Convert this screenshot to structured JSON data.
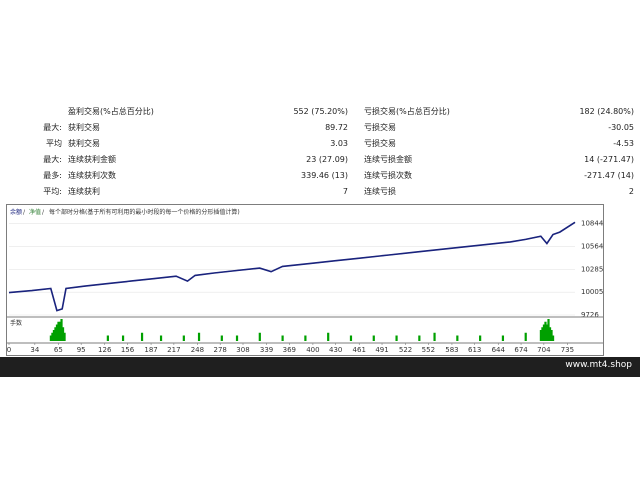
{
  "stats": {
    "rows": [
      {
        "prefix": "",
        "label1": "盈利交易(%占总百分比)",
        "value1": "552 (75.20%)",
        "label2": "亏损交易(%占总百分比)",
        "value2": "182 (24.80%)"
      },
      {
        "prefix": "最大:",
        "label1": "获利交易",
        "value1": "89.72",
        "label2": "亏损交易",
        "value2": "-30.05"
      },
      {
        "prefix": "平均",
        "label1": "获利交易",
        "value1": "3.03",
        "label2": "亏损交易",
        "value2": "-4.53"
      },
      {
        "prefix": "最大:",
        "label1": "连续获利金额",
        "value1": "23 (27.09)",
        "label2": "连续亏损金额",
        "value2": "14 (-271.47)"
      },
      {
        "prefix": "最多:",
        "label1": "连续获利次数",
        "value1": "339.46 (13)",
        "label2": "连续亏损次数",
        "value2": "-271.47 (14)"
      },
      {
        "prefix": "平均:",
        "label1": "连续获利",
        "value1": "7",
        "label2": "连续亏损",
        "value2": "2"
      }
    ]
  },
  "chart": {
    "legend_balance": "余额",
    "legend_equity": "净值",
    "legend_desc": "每个部时分格(基于所有可利用的最小时段的每一个价格的分形插值计算)",
    "volume_label": "手数",
    "colors": {
      "balance": "#1a237e",
      "equity": "#2e7d32",
      "volume": "#00a000"
    }
  },
  "chart_data": {
    "type": "line",
    "x_ticks": [
      0,
      34,
      65,
      95,
      126,
      156,
      187,
      217,
      248,
      278,
      308,
      339,
      369,
      400,
      430,
      461,
      491,
      522,
      552,
      583,
      613,
      644,
      674,
      704,
      735
    ],
    "y_ticks": [
      9726,
      10005,
      10285,
      10564,
      10844
    ],
    "xlim": [
      0,
      745
    ],
    "ylim": [
      9726,
      10900
    ],
    "series": [
      {
        "values_x": [
          0,
          30,
          55,
          63,
          70,
          75,
          100,
          130,
          160,
          190,
          220,
          235,
          245,
          270,
          300,
          330,
          345,
          360,
          400,
          430,
          460,
          500,
          540,
          580,
          620,
          660,
          680,
          700,
          708,
          716,
          725,
          745
        ],
        "values_y": [
          10000,
          10025,
          10050,
          9780,
          9800,
          10050,
          10080,
          10110,
          10140,
          10170,
          10200,
          10140,
          10210,
          10240,
          10270,
          10300,
          10255,
          10320,
          10360,
          10390,
          10420,
          10460,
          10500,
          10540,
          10580,
          10620,
          10650,
          10690,
          10600,
          10710,
          10740,
          10860
        ]
      }
    ],
    "volume_x": [
      55,
      57,
      59,
      61,
      63,
      65,
      67,
      69,
      71,
      73,
      130,
      150,
      175,
      200,
      230,
      250,
      280,
      300,
      330,
      360,
      390,
      420,
      450,
      480,
      510,
      540,
      560,
      590,
      620,
      650,
      680,
      700,
      702,
      704,
      706,
      708,
      710,
      712,
      714,
      716
    ],
    "volume_y": [
      2,
      3,
      4,
      5,
      6,
      7,
      7,
      8,
      5,
      3,
      2,
      2,
      3,
      2,
      2,
      3,
      2,
      2,
      3,
      2,
      2,
      3,
      2,
      2,
      2,
      2,
      3,
      2,
      2,
      2,
      3,
      4,
      5,
      6,
      7,
      6,
      8,
      5,
      4,
      2
    ]
  },
  "footer": {
    "brand": "www.mt4.shop"
  }
}
